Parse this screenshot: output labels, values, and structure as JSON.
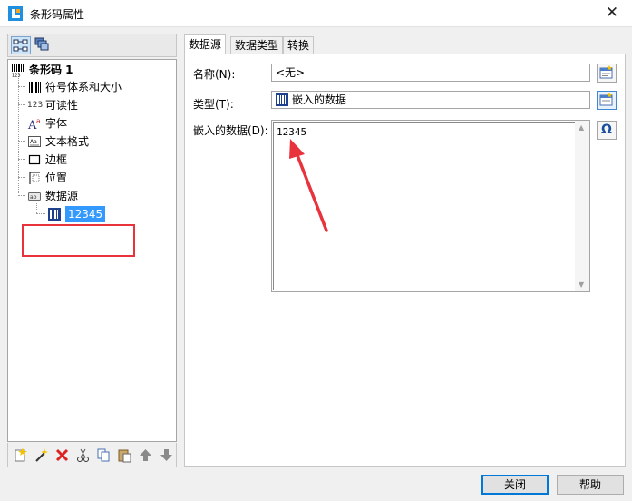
{
  "window": {
    "title": "条形码属性",
    "close_glyph": "✕"
  },
  "left_toolbar": {
    "buttons": [
      {
        "icon": "structure-view-icon"
      },
      {
        "icon": "layers-view-icon"
      }
    ]
  },
  "tree": {
    "root": {
      "label": "条形码 1",
      "icon": "barcode-icon"
    },
    "items": [
      {
        "label": "符号体系和大小",
        "icon": "barcode-symbology-icon"
      },
      {
        "label": "可读性",
        "icon": "readable-123-icon",
        "icon_text": "123"
      },
      {
        "label": "字体",
        "icon": "font-icon"
      },
      {
        "label": "文本格式",
        "icon": "text-format-icon"
      },
      {
        "label": "边框",
        "icon": "border-icon"
      },
      {
        "label": "位置",
        "icon": "position-icon"
      },
      {
        "label": "数据源",
        "icon": "data-source-icon"
      }
    ],
    "selected_child": {
      "label": "12345",
      "icon": "embedded-data-icon"
    }
  },
  "bottom_toolbar": {
    "icons": [
      "new-icon",
      "wizard-icon",
      "delete-icon",
      "cut-icon",
      "copy-icon",
      "paste-icon",
      "move-up-icon",
      "move-down-icon"
    ]
  },
  "tabs": [
    {
      "label": "数据源",
      "active": true
    },
    {
      "label": "数据类型",
      "active": false
    },
    {
      "label": "转换",
      "active": false
    }
  ],
  "form": {
    "name_label": "名称(N):",
    "name_value": "<无>",
    "type_label": "类型(T):",
    "type_value": "嵌入的数据",
    "data_label": "嵌入的数据(D):",
    "data_value": "12345",
    "omega_glyph": "Ω"
  },
  "footer": {
    "close_label": "关闭",
    "help_label": "帮助"
  },
  "colors": {
    "highlight": "#3399ff",
    "annotation_red": "#e8333d"
  }
}
